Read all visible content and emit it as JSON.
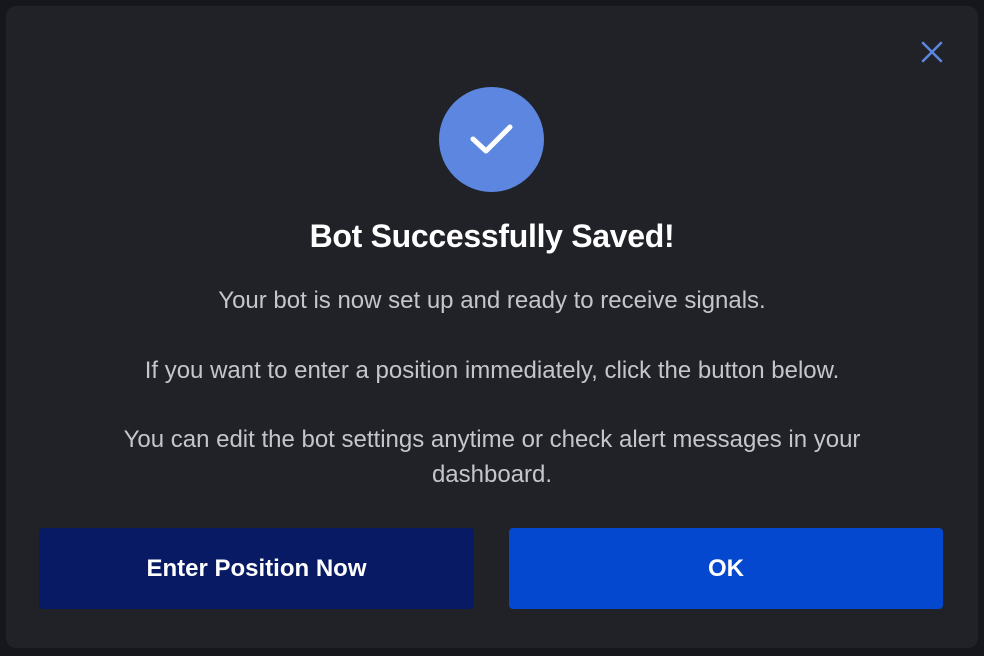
{
  "dialog": {
    "title": "Bot Successfully Saved!",
    "message_line1": "Your bot is now set up and ready to receive signals.",
    "message_line2": "If you want to enter a position immediately, click the button below.",
    "message_line3": "You can edit the bot settings anytime or check alert messages in your dashboard.",
    "close_icon": "close-icon",
    "success_icon": "checkmark-icon",
    "enter_position_label": "Enter Position Now",
    "ok_label": "OK"
  },
  "colors": {
    "modal_bg": "#202228",
    "success_circle": "#5c86e0",
    "close_icon": "#5c86e0",
    "enter_button": "#071a63",
    "ok_button": "#0448cf"
  }
}
